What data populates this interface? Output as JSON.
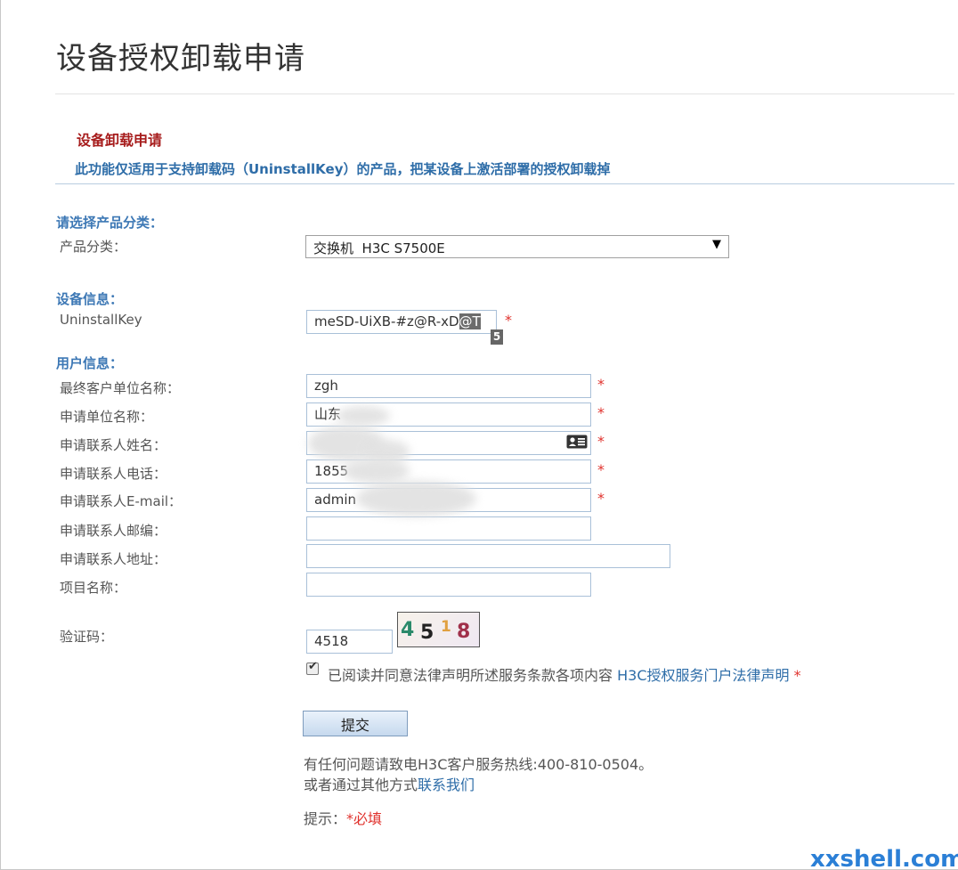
{
  "page": {
    "title": "设备授权卸载申请"
  },
  "section": {
    "title": "设备卸载申请",
    "description": "此功能仅适用于支持卸载码（UninstallKey）的产品，把某设备上激活部署的授权卸载掉"
  },
  "product": {
    "heading": "请选择产品分类：",
    "label": "产品分类：",
    "selected": "交换机  H3C S7500E"
  },
  "device": {
    "heading": "设备信息：",
    "label": "UninstallKey",
    "value_plain": "meSD-UiXB-#z@R-xD",
    "value_selected": "@T",
    "tooltip": "5"
  },
  "user": {
    "heading": "用户信息：",
    "fields": [
      {
        "label": "最终客户单位名称：",
        "value": "zgh",
        "required": "*"
      },
      {
        "label": "申请单位名称：",
        "value": "山东",
        "required": "*"
      },
      {
        "label": "申请联系人姓名：",
        "value": "",
        "required": "*"
      },
      {
        "label": "申请联系人电话：",
        "value": "1855",
        "required": "*"
      },
      {
        "label": "申请联系人E-mail：",
        "value": "admin",
        "required": "*"
      },
      {
        "label": "申请联系人邮编：",
        "value": "",
        "required": ""
      },
      {
        "label": "申请联系人地址：",
        "value": "",
        "required": ""
      },
      {
        "label": "项目名称：",
        "value": "",
        "required": ""
      }
    ]
  },
  "captcha": {
    "label": "验证码：",
    "value": "4518",
    "chars": [
      "4",
      "5",
      "1",
      "8"
    ],
    "colors": [
      "#2a8a6a",
      "#222222",
      "#e0a040",
      "#a0304a"
    ]
  },
  "agreement": {
    "text": "已阅读并同意法律声明所述服务条款各项内容",
    "link": "H3C授权服务门户法律声明",
    "required": "*"
  },
  "submit": {
    "label": "提交"
  },
  "help": {
    "line1": "有任何问题请致电H3C客户服务热线:400-810-0504。",
    "line2_prefix": "或者通过其他方式",
    "line2_link": "联系我们"
  },
  "hint": {
    "prefix": "提示：",
    "required": "*必填"
  },
  "watermark": "xxshell.com",
  "colors": {
    "link": "#2e6da8",
    "required": "#e0322d",
    "section_title": "#a71d1d",
    "group_heading": "#3d78b5"
  },
  "icons": {
    "select_arrow": "triangle-down-icon",
    "contact_card": "contact-card-icon",
    "checkbox": "checkmark-icon"
  }
}
